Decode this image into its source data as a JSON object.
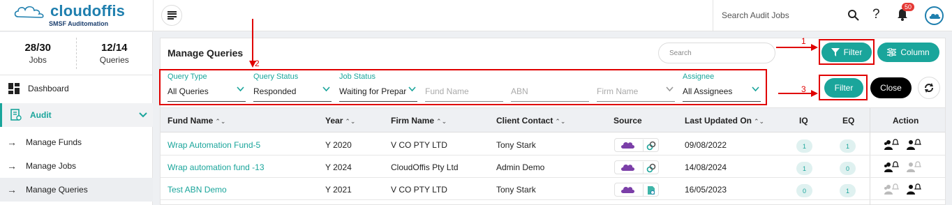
{
  "brand": {
    "name": "cloudoffis",
    "tagline": "SMSF Auditomation"
  },
  "topbar": {
    "search_label": "Search Audit Jobs",
    "notification_count": "50"
  },
  "sidebar": {
    "stats": [
      {
        "value": "28/30",
        "label": "Jobs"
      },
      {
        "value": "12/14",
        "label": "Queries"
      }
    ],
    "items": [
      {
        "label": "Dashboard"
      },
      {
        "label": "Audit"
      },
      {
        "label": "Manage Funds"
      },
      {
        "label": "Manage Jobs"
      },
      {
        "label": "Manage Queries"
      }
    ]
  },
  "page": {
    "title": "Manage Queries",
    "search_placeholder": "Search",
    "filter_button": "Filter",
    "column_button": "Column",
    "apply_filter_button": "Filter",
    "close_button": "Close"
  },
  "filters": {
    "query_type": {
      "label": "Query Type",
      "value": "All Queries"
    },
    "query_status": {
      "label": "Query Status",
      "value": "Responded"
    },
    "job_status": {
      "label": "Job Status",
      "value": "Waiting for Preparer"
    },
    "fund_name": {
      "placeholder": "Fund Name"
    },
    "abn": {
      "placeholder": "ABN"
    },
    "firm_name": {
      "placeholder": "Firm Name"
    },
    "assignee": {
      "label": "Assignee",
      "value": "All Assignees"
    }
  },
  "table": {
    "columns": [
      "Fund Name",
      "Year",
      "Firm Name",
      "Client Contact",
      "Source",
      "Last Updated On",
      "IQ",
      "EQ",
      "Action"
    ],
    "rows": [
      {
        "fund": "Wrap Automation Fund-5",
        "year": "Y 2020",
        "firm": "V CO PTY LTD",
        "contact": "Tony Stark",
        "updated": "09/08/2022",
        "iq": "1",
        "eq": "1"
      },
      {
        "fund": "Wrap automation fund -13",
        "year": "Y 2024",
        "firm": "CloudOffis Pty Ltd",
        "contact": "Admin Demo",
        "updated": "14/08/2024",
        "iq": "1",
        "eq": "0"
      },
      {
        "fund": "Test ABN Demo",
        "year": "Y 2021",
        "firm": "V CO PTY LTD",
        "contact": "Tony Stark",
        "updated": "16/05/2023",
        "iq": "0",
        "eq": "1"
      }
    ]
  },
  "annotations": {
    "one": "1",
    "two": "2",
    "three": "3"
  },
  "colors": {
    "accent": "#1aa59b",
    "brand": "#1f7fae",
    "annotation": "#e00000"
  }
}
